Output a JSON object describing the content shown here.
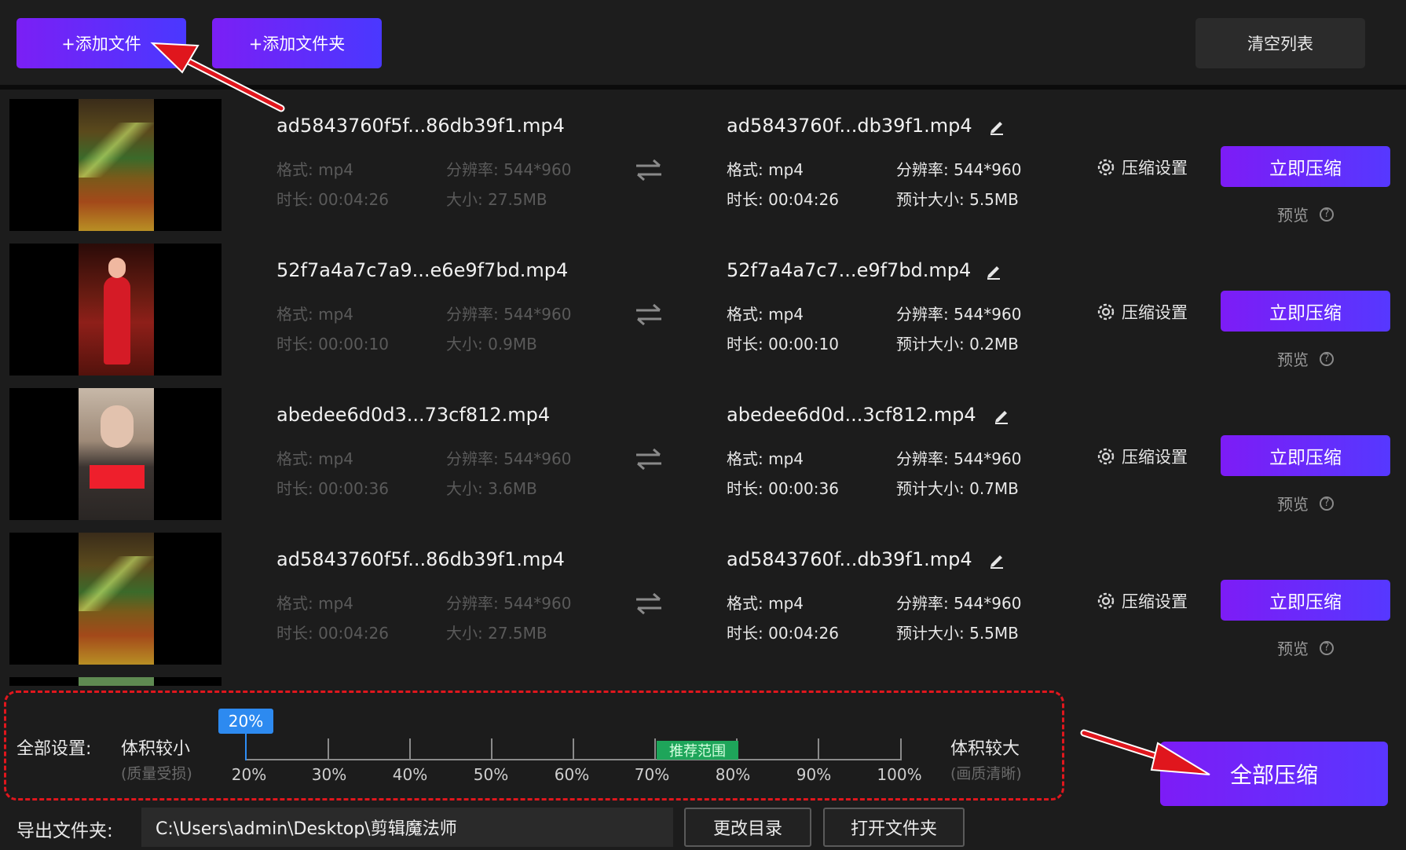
{
  "toolbar": {
    "add_file": "+添加文件",
    "add_folder": "+添加文件夹",
    "clear_list": "清空列表"
  },
  "files": [
    {
      "src_name": "ad5843760f5f...86db39f1.mp4",
      "src_format": "格式: mp4",
      "src_resolution": "分辨率: 544*960",
      "src_duration": "时长: 00:04:26",
      "src_size": "大小: 27.5MB",
      "dst_name": "ad5843760f...db39f1.mp4",
      "dst_format": "格式: mp4",
      "dst_resolution": "分辨率: 544*960",
      "dst_duration": "时长: 00:04:26",
      "dst_size": "预计大小: 5.5MB",
      "settings": "压缩设置",
      "compress": "立即压缩",
      "preview": "预览",
      "help": "?"
    },
    {
      "src_name": "52f7a4a7c7a9...e6e9f7bd.mp4",
      "src_format": "格式: mp4",
      "src_resolution": "分辨率: 544*960",
      "src_duration": "时长: 00:00:10",
      "src_size": "大小: 0.9MB",
      "dst_name": "52f7a4a7c7...e9f7bd.mp4",
      "dst_format": "格式: mp4",
      "dst_resolution": "分辨率: 544*960",
      "dst_duration": "时长: 00:00:10",
      "dst_size": "预计大小: 0.2MB",
      "settings": "压缩设置",
      "compress": "立即压缩",
      "preview": "预览",
      "help": "?"
    },
    {
      "src_name": "abedee6d0d3...73cf812.mp4",
      "src_format": "格式: mp4",
      "src_resolution": "分辨率: 544*960",
      "src_duration": "时长: 00:00:36",
      "src_size": "大小: 3.6MB",
      "dst_name": "abedee6d0d...3cf812.mp4",
      "dst_format": "格式: mp4",
      "dst_resolution": "分辨率: 544*960",
      "dst_duration": "时长: 00:00:36",
      "dst_size": "预计大小: 0.7MB",
      "settings": "压缩设置",
      "compress": "立即压缩",
      "preview": "预览",
      "help": "?"
    },
    {
      "src_name": "ad5843760f5f...86db39f1.mp4",
      "src_format": "格式: mp4",
      "src_resolution": "分辨率: 544*960",
      "src_duration": "时长: 00:04:26",
      "src_size": "大小: 27.5MB",
      "dst_name": "ad5843760f...db39f1.mp4",
      "dst_format": "格式: mp4",
      "dst_resolution": "分辨率: 544*960",
      "dst_duration": "时长: 00:04:26",
      "dst_size": "预计大小: 5.5MB",
      "settings": "压缩设置",
      "compress": "立即压缩",
      "preview": "预览",
      "help": "?"
    }
  ],
  "settings_panel": {
    "label": "全部设置:",
    "small_title": "体积较小",
    "small_sub": "(质量受损)",
    "large_title": "体积较大",
    "large_sub": "(画质清晰)",
    "current_value": "20%",
    "recommended": "推荐范围",
    "ticks": [
      "20%",
      "30%",
      "40%",
      "50%",
      "60%",
      "70%",
      "80%",
      "90%",
      "100%"
    ]
  },
  "compress_all": "全部压缩",
  "export": {
    "label": "导出文件夹:",
    "path": "C:\\Users\\admin\\Desktop\\剪辑魔法师",
    "change_dir": "更改目录",
    "open_folder": "打开文件夹"
  },
  "colors": {
    "accent_start": "#7b1ff5",
    "accent_end": "#4a38ff",
    "annotation_red": "#e0161d",
    "slider_blue": "#2d8af0",
    "recommended_green": "#1ea55a"
  }
}
